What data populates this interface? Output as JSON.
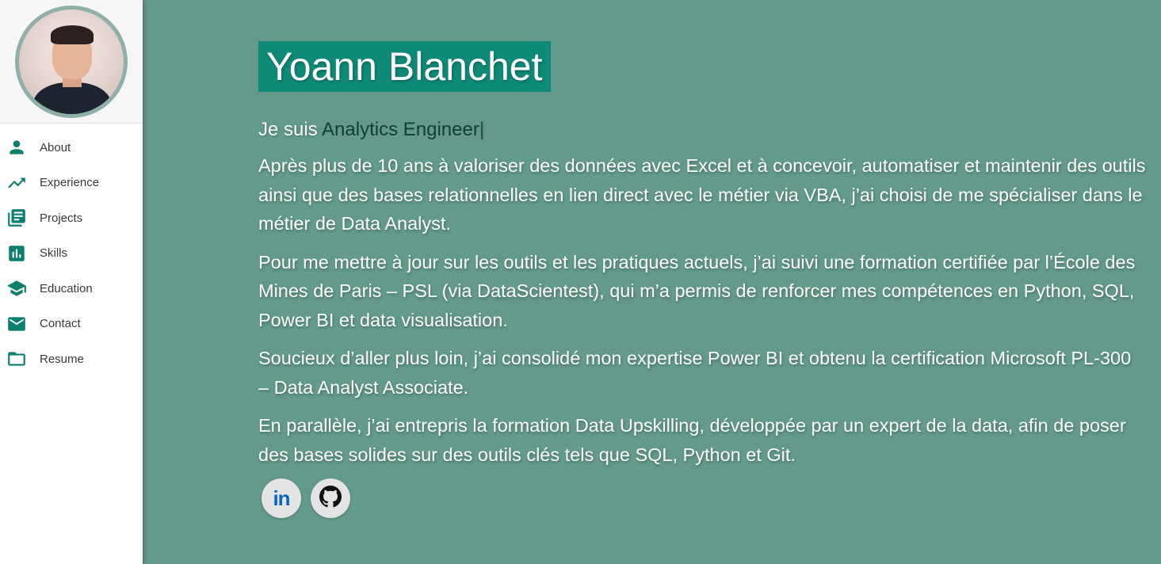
{
  "sidebar": {
    "items": [
      {
        "label": "About",
        "icon": "person-icon"
      },
      {
        "label": "Experience",
        "icon": "trending-up-icon"
      },
      {
        "label": "Projects",
        "icon": "library-books-icon"
      },
      {
        "label": "Skills",
        "icon": "bar-chart-icon"
      },
      {
        "label": "Education",
        "icon": "school-icon"
      },
      {
        "label": "Contact",
        "icon": "mail-icon"
      },
      {
        "label": "Resume",
        "icon": "folder-icon"
      }
    ]
  },
  "hero": {
    "name": "Yoann Blanchet",
    "role_prefix": "Je suis ",
    "role_highlight": "Analytics Engineer",
    "cursor": "|",
    "paragraphs": [
      "Après plus de 10 ans à valoriser des données avec Excel et à concevoir, automatiser et maintenir des outils ainsi que des bases relationnelles en lien direct avec le métier via VBA, j’ai choisi de me spécialiser dans le métier de Data Analyst.",
      "Pour me mettre à jour sur les outils et les pratiques actuels, j’ai suivi une formation certifiée par l’École des Mines de Paris – PSL (via DataScientest), qui m’a permis de renforcer mes compétences en Python, SQL, Power BI et data visualisation.",
      "Soucieux d’aller plus loin, j’ai consolidé mon expertise Power BI et obtenu la certification Microsoft PL-300 – Data Analyst Associate.",
      "En parallèle, j’ai entrepris la formation Data Upskilling, développée par un expert de la data, afin de poser des bases solides sur des outils clés tels que SQL, Python et Git."
    ]
  },
  "socials": {
    "linkedin_label": "in",
    "linkedin_icon": "linkedin-icon",
    "github_icon": "github-icon"
  },
  "colors": {
    "background": "#639a8c",
    "accent": "#0e8a76",
    "sidebar_icon": "#0d7f6f"
  }
}
